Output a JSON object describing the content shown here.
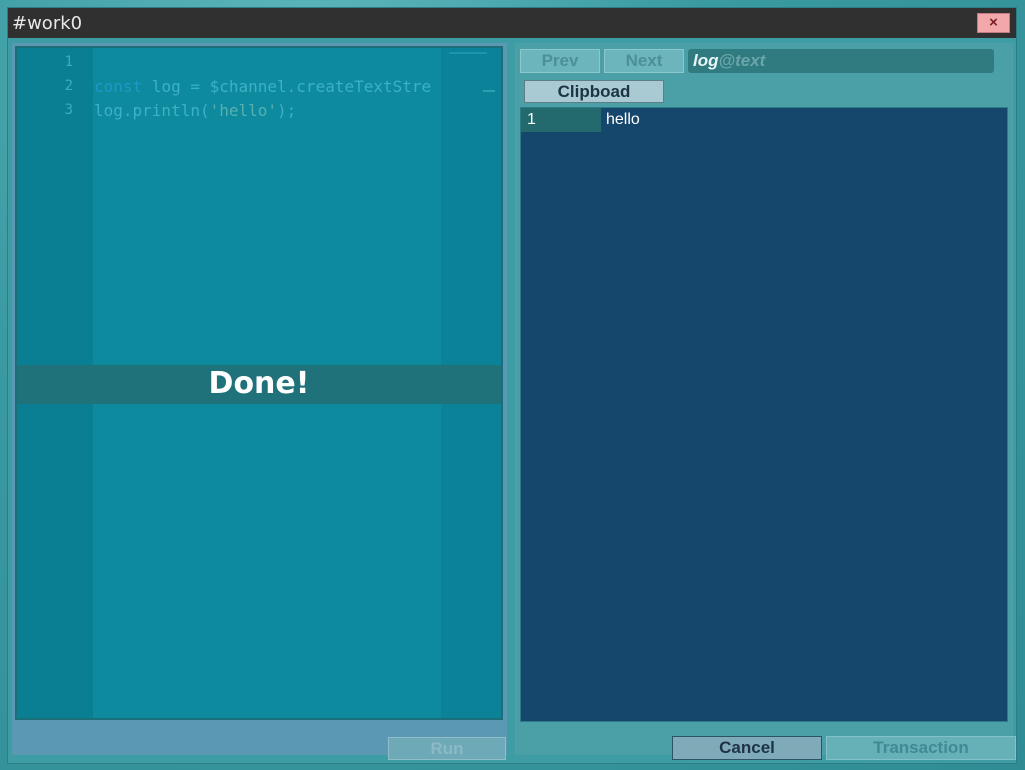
{
  "window": {
    "title": "#work0",
    "close_label": "×"
  },
  "editor": {
    "line_numbers": [
      "1",
      "2",
      "3"
    ],
    "lines": [
      {
        "tokens": []
      },
      {
        "tokens": [
          {
            "text": "const",
            "cls": "kw"
          },
          {
            "text": " log = $channel.createTextStre",
            "cls": ""
          }
        ]
      },
      {
        "tokens": [
          {
            "text": "log.println(",
            "cls": ""
          },
          {
            "text": "'hello'",
            "cls": "str"
          },
          {
            "text": ");",
            "cls": ""
          }
        ]
      }
    ],
    "status_overlay": "Done!",
    "run_label": "Run"
  },
  "log_panel": {
    "prev_label": "Prev",
    "next_label": "Next",
    "filter_value": "log",
    "filter_placeholder": "@text",
    "clipboard_label": "Clipboad",
    "entries": [
      {
        "index": "1",
        "text": "hello"
      }
    ],
    "cancel_label": "Cancel",
    "transaction_label": "Transaction"
  }
}
